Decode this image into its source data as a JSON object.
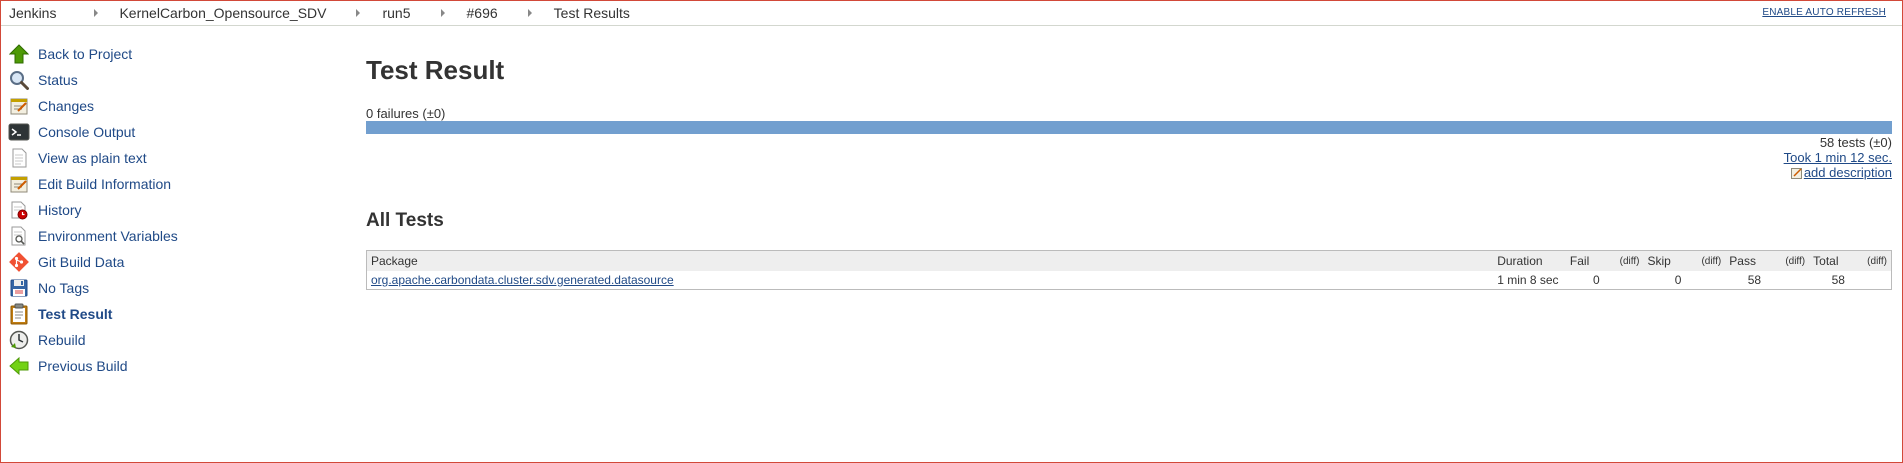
{
  "breadcrumbs": [
    "Jenkins",
    "KernelCarbon_Opensource_SDV",
    "run5",
    "#696",
    "Test Results"
  ],
  "auto_refresh": "ENABLE AUTO REFRESH",
  "sidebar": {
    "items": [
      {
        "label": "Back to Project",
        "icon": "up-arrow-icon"
      },
      {
        "label": "Status",
        "icon": "magnifier-icon"
      },
      {
        "label": "Changes",
        "icon": "notepad-icon"
      },
      {
        "label": "Console Output",
        "icon": "terminal-icon"
      },
      {
        "label": "View as plain text",
        "icon": "document-icon"
      },
      {
        "label": "Edit Build Information",
        "icon": "notepad-icon"
      },
      {
        "label": "History",
        "icon": "history-icon"
      },
      {
        "label": "Environment Variables",
        "icon": "document-search-icon"
      },
      {
        "label": "Git Build Data",
        "icon": "git-icon"
      },
      {
        "label": "No Tags",
        "icon": "floppy-icon"
      },
      {
        "label": "Test Result",
        "icon": "clipboard-icon",
        "active": true
      },
      {
        "label": "Rebuild",
        "icon": "clock-icon"
      },
      {
        "label": "Previous Build",
        "icon": "left-arrow-icon"
      }
    ]
  },
  "main": {
    "title": "Test Result",
    "failures": "0 failures (±0)",
    "pass_fraction": 1.0,
    "tests_count": "58 tests (±0)",
    "took": "Took 1 min 12 sec.",
    "add_description": "add description",
    "all_tests_title": "All Tests",
    "table": {
      "headers": {
        "package": "Package",
        "duration": "Duration",
        "fail": "Fail",
        "fail_diff": "(diff)",
        "skip": "Skip",
        "skip_diff": "(diff)",
        "pass": "Pass",
        "pass_diff": "(diff)",
        "total": "Total",
        "total_diff": "(diff)"
      },
      "rows": [
        {
          "package": "org.apache.carbondata.cluster.sdv.generated.datasource",
          "duration": "1 min 8 sec",
          "fail": "0",
          "skip": "0",
          "pass": "58",
          "total": "58"
        }
      ]
    }
  },
  "colors": {
    "frame_border": "#d24939",
    "link": "#204a87",
    "pass_bar": "#729fcf"
  }
}
